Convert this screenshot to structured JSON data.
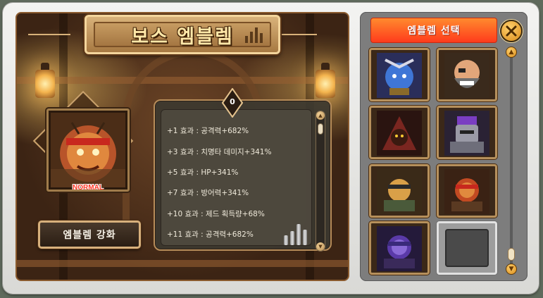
{
  "window": {
    "title": "보스 엠블렘"
  },
  "emblem": {
    "rank_label": "NORMAL",
    "portrait": "lion-warrior-portrait"
  },
  "enhance_button": {
    "label": "엠블렘 강화"
  },
  "level": {
    "value": "0"
  },
  "effects": [
    "+1 효과 : 공격력+682%",
    "+3 효과 : 치명타 데미지+341%",
    "+5 효과 : HP+341%",
    "+7 효과 : 방어력+341%",
    "+10 효과 : 제드 획득량+68%",
    "+11 효과 : 공격력+682%"
  ],
  "selector": {
    "title": "엠블렘 선택",
    "close_icon": "close-x-icon",
    "slots": [
      {
        "portrait": "blue-elf-boss",
        "accent": "#2a63c9"
      },
      {
        "portrait": "bearded-warrior-boss",
        "accent": "#8a5a2e"
      },
      {
        "portrait": "hooded-spider-boss",
        "accent": "#8b2b2b"
      },
      {
        "portrait": "purple-armored-knight",
        "accent": "#6a3fb0"
      },
      {
        "portrait": "armored-lion-warrior",
        "accent": "#c89a3a"
      },
      {
        "portrait": "red-lion-warrior",
        "accent": "#c23a20"
      },
      {
        "portrait": "purple-lion-warrior",
        "accent": "#5a3aa8"
      },
      {
        "portrait": "empty-slot",
        "accent": "#4a4a4a"
      }
    ]
  },
  "colors": {
    "header_orange": "#ff5a22",
    "gold_trim": "#d7b07c",
    "normal_red": "#ff3b2a"
  }
}
